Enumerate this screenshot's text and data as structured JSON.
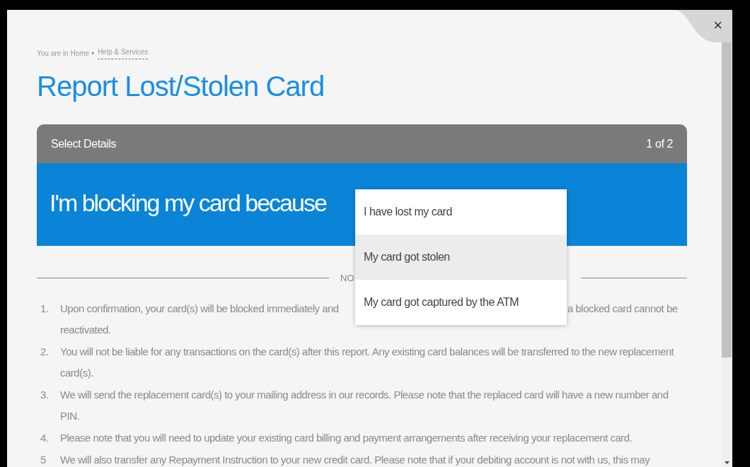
{
  "breadcrumb": {
    "prefix": "You are in Home",
    "separator": "▸",
    "link": "Help & Services"
  },
  "close_label": "×",
  "title": "Report Lost/Stolen Card",
  "step_header": {
    "label": "Select Details",
    "step": "1 of 2"
  },
  "question": "I'm blocking my card because",
  "dropdown": {
    "options": [
      {
        "label": "I have lost my card",
        "highlighted": false
      },
      {
        "label": "My card got stolen",
        "highlighted": true
      },
      {
        "label": "My card got captured by the ATM",
        "highlighted": false
      }
    ]
  },
  "divider_label": "NO",
  "notes": [
    {
      "number": "1.",
      "left": "Upon confirmation, your card(s) will be blocked immediately and",
      "right": "a blocked card cannot be",
      "rest": "reactivated."
    },
    {
      "number": "2.",
      "text": "You will not be liable for any transactions on the card(s) after this report. Any existing card balances will be transferred to the new replacement card(s)."
    },
    {
      "number": "3.",
      "text": "We will send the replacement card(s) to your mailing address in our records. Please note that the replaced card will have a new number and PIN."
    },
    {
      "number": "4.",
      "text": "Please note that you will need to update your existing card billing and payment arrangements after receiving your replacement card."
    },
    {
      "number": "5",
      "text": "We will also transfer any Repayment Instruction to your new credit card. Please note that if your debiting account is not with us, this may"
    }
  ]
}
